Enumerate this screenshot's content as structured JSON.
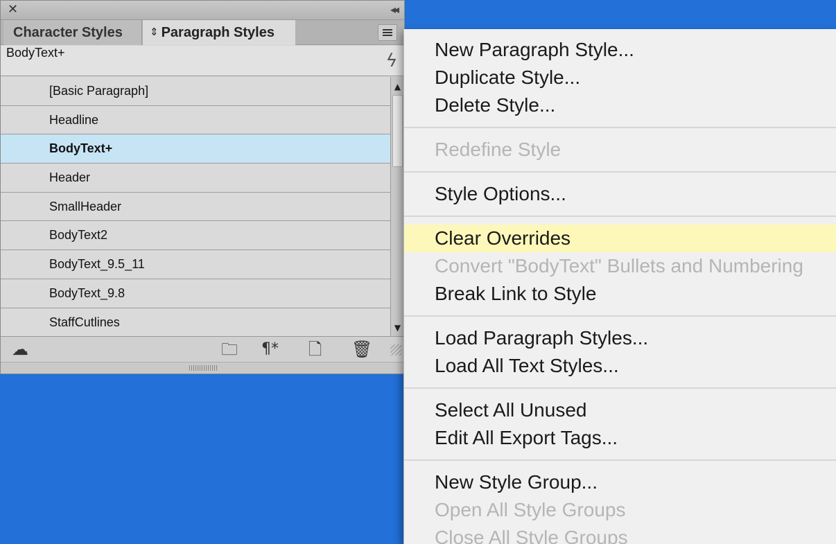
{
  "panel": {
    "close_glyph": "✕",
    "collapse_glyph": "◂◂",
    "tabs": [
      {
        "label": "Character Styles"
      },
      {
        "label": "Paragraph Styles",
        "prefix": "⇕"
      }
    ],
    "current_style": "BodyText+",
    "styles": [
      {
        "label": "[Basic Paragraph]"
      },
      {
        "label": "Headline"
      },
      {
        "label": "BodyText+",
        "selected": true
      },
      {
        "label": "Header"
      },
      {
        "label": "SmallHeader"
      },
      {
        "label": "BodyText2"
      },
      {
        "label": "BodyText_9.5_11"
      },
      {
        "label": "BodyText_9.8"
      },
      {
        "label": "StaffCutlines"
      }
    ],
    "footer_icons": [
      "cloud-library-icon",
      "new-group-folder-icon",
      "clear-overrides-icon",
      "new-style-icon",
      "trash-icon"
    ],
    "selected_row_color": "#c7e4f5"
  },
  "menu": {
    "items": [
      {
        "label": "New Paragraph Style...",
        "enabled": true
      },
      {
        "label": "Duplicate Style...",
        "enabled": true
      },
      {
        "label": "Delete Style...",
        "enabled": true
      },
      {
        "label": "Redefine Style",
        "enabled": false
      },
      {
        "label": "Style Options...",
        "enabled": true
      },
      {
        "label": "Clear Overrides",
        "enabled": true,
        "highlighted": true
      },
      {
        "label": "Convert \"BodyText\" Bullets and Numbering",
        "enabled": false
      },
      {
        "label": "Break Link to Style",
        "enabled": true
      },
      {
        "label": "Load Paragraph Styles...",
        "enabled": true
      },
      {
        "label": "Load All Text Styles...",
        "enabled": true
      },
      {
        "label": "Select All Unused",
        "enabled": true
      },
      {
        "label": "Edit All Export Tags...",
        "enabled": true
      },
      {
        "label": "New Style Group...",
        "enabled": true
      },
      {
        "label": "Open All Style Groups",
        "enabled": false
      },
      {
        "label": "Close All Style Groups",
        "enabled": false
      }
    ],
    "highlight_color": "#fdf8b9",
    "disabled_color": "#b5b5b5"
  },
  "desktop_color": "#2270d8"
}
